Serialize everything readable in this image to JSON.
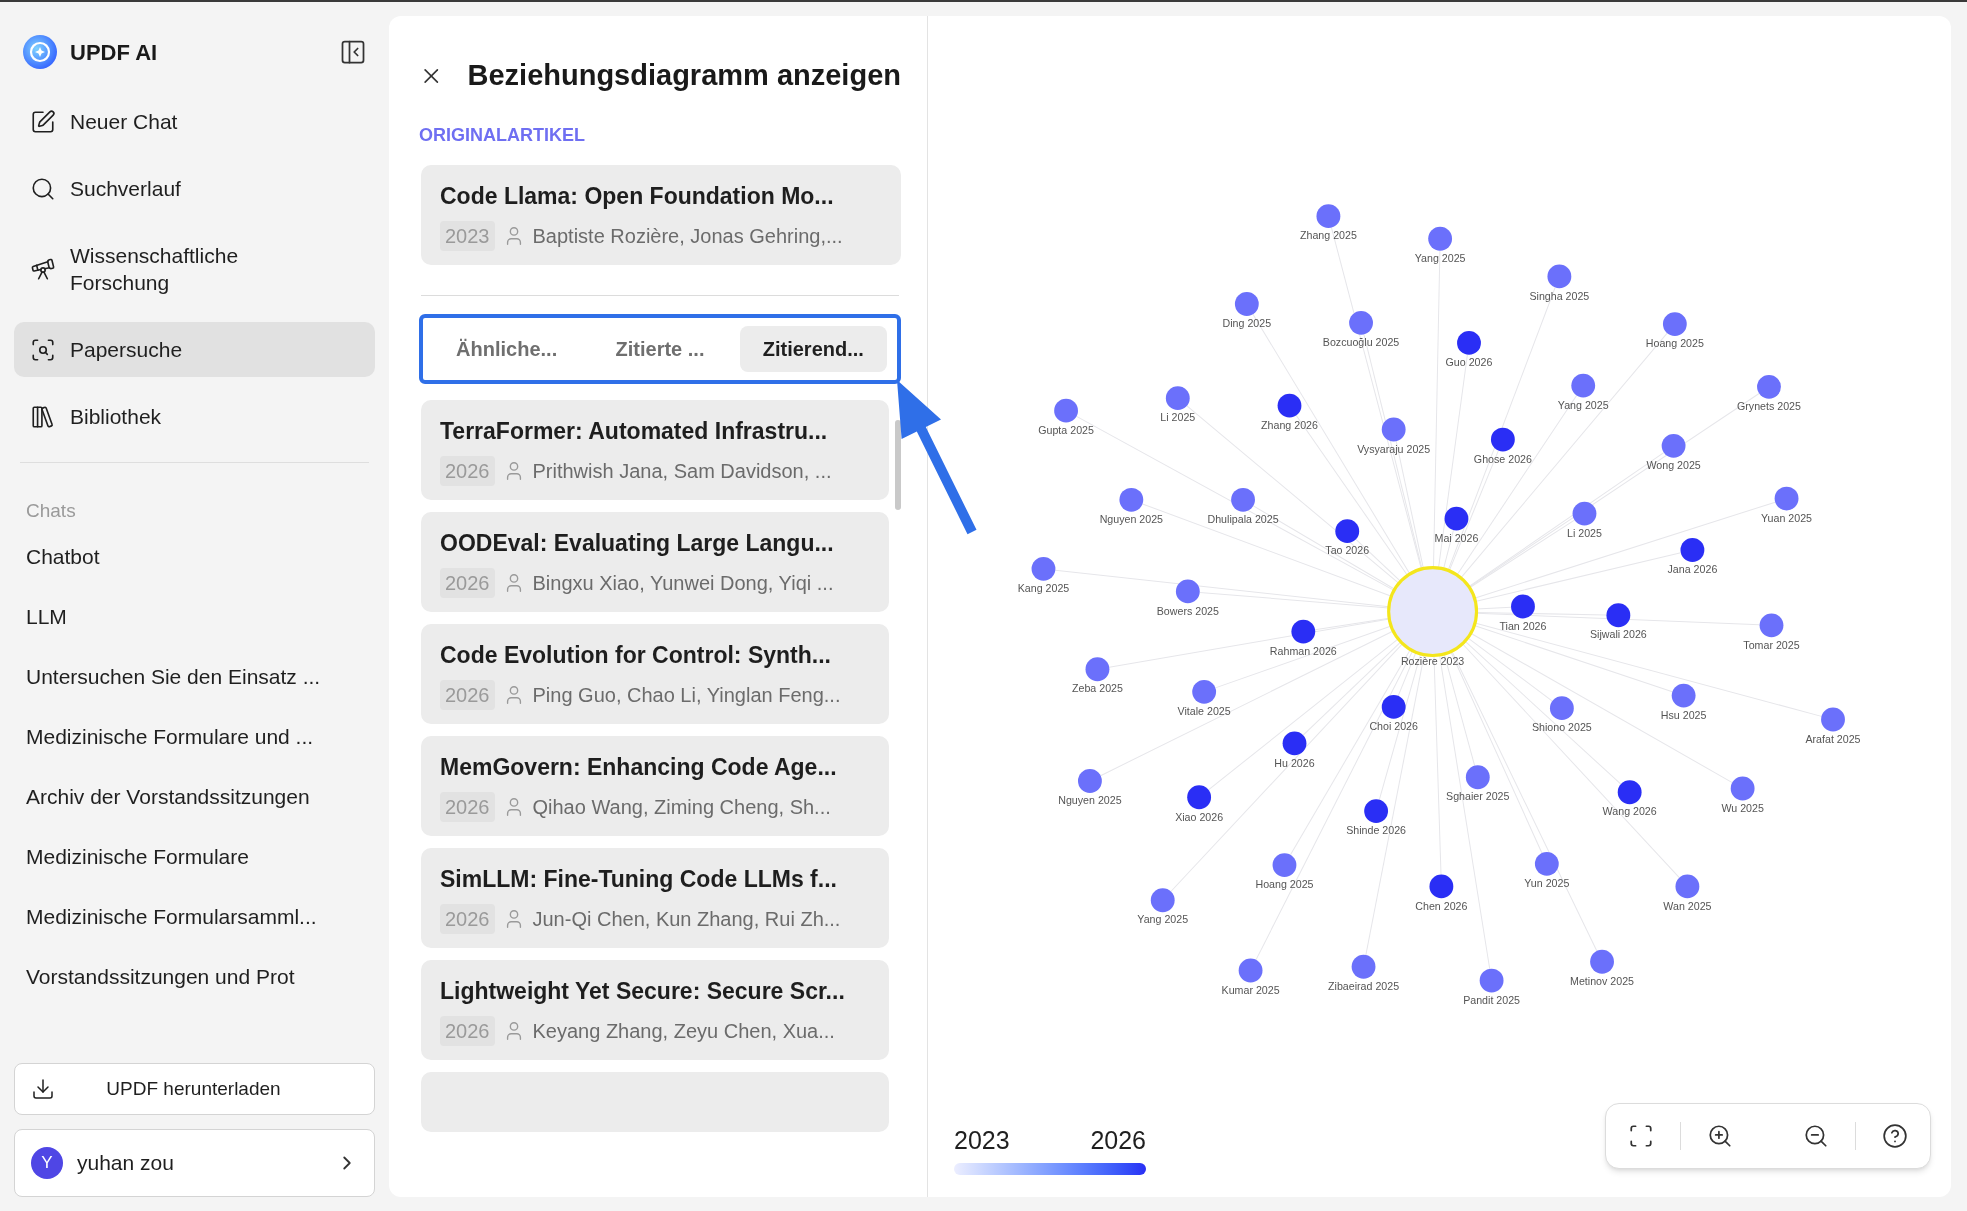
{
  "app": {
    "name": "UPDF AI"
  },
  "sidebar": {
    "nav": [
      {
        "label": "Neuer Chat",
        "selected": false
      },
      {
        "label": "Suchverlauf",
        "selected": false
      },
      {
        "label": "Wissenschaftliche Forschung",
        "selected": false
      },
      {
        "label": "Papersuche",
        "selected": true
      },
      {
        "label": "Bibliothek",
        "selected": false
      }
    ],
    "chats_heading": "Chats",
    "chats": [
      "Chatbot",
      "LLM",
      "Untersuchen Sie den Einsatz ...",
      "Medizinische Formulare und ...",
      "Archiv der Vorstandssitzungen",
      "Medizinische Formulare",
      "Medizinische Formularsamml...",
      "Vorstandssitzungen und Prot"
    ],
    "download_button": "UPDF herunterladen",
    "user": {
      "initial": "Y",
      "name": "yuhan zou"
    }
  },
  "panel": {
    "title": "Beziehungsdiagramm anzeigen",
    "section_label": "ORIGINALARTIKEL",
    "original": {
      "title": "Code Llama: Open Foundation Mo...",
      "year": "2023",
      "authors": "Baptiste Rozière, Jonas Gehring,..."
    },
    "tabs": [
      {
        "label": "Ähnliche...",
        "selected": false
      },
      {
        "label": "Zitierte ...",
        "selected": false
      },
      {
        "label": "Zitierend...",
        "selected": true
      }
    ],
    "papers": [
      {
        "title": "TerraFormer: Automated Infrastru...",
        "year": "2026",
        "authors": "Prithwish Jana, Sam Davidson, ..."
      },
      {
        "title": "OODEval: Evaluating Large Langu...",
        "year": "2026",
        "authors": "Bingxu Xiao, Yunwei Dong, Yiqi ..."
      },
      {
        "title": "Code Evolution for Control: Synth...",
        "year": "2026",
        "authors": "Ping Guo, Chao Li, Yinglan Feng..."
      },
      {
        "title": "MemGovern: Enhancing Code Age...",
        "year": "2026",
        "authors": "Qihao Wang, Ziming Cheng, Sh..."
      },
      {
        "title": "SimLLM: Fine-Tuning Code LLMs f...",
        "year": "2026",
        "authors": "Jun-Qi Chen, Kun Zhang, Rui Zh..."
      },
      {
        "title": "Lightweight Yet Secure: Secure Scr...",
        "year": "2026",
        "authors": "Keyang Zhang, Zeyu Chen, Xua..."
      }
    ]
  },
  "graph": {
    "center": {
      "label": "Rozière 2023"
    },
    "nodes": [
      {
        "label": "Zhang 2025",
        "color": "#6b70fb"
      },
      {
        "label": "Yang 2025",
        "color": "#6b70fb"
      },
      {
        "label": "Singha 2025",
        "color": "#6b70fb"
      },
      {
        "label": "Ding 2025",
        "color": "#6b70fb"
      },
      {
        "label": "Bozcuoğlu 2025",
        "color": "#6b70fb"
      },
      {
        "label": "Guo 2026",
        "color": "#2a2ef5"
      },
      {
        "label": "Hoang 2025",
        "color": "#6b70fb"
      },
      {
        "label": "Gupta 2025",
        "color": "#6b70fb"
      },
      {
        "label": "Li 2025",
        "color": "#6b70fb"
      },
      {
        "label": "Zhang 2026",
        "color": "#2a2ef5"
      },
      {
        "label": "Yang 2025",
        "color": "#6b70fb"
      },
      {
        "label": "Grynets 2025",
        "color": "#6b70fb"
      },
      {
        "label": "Vysyaraju 2025",
        "color": "#6b70fb"
      },
      {
        "label": "Ghose 2026",
        "color": "#2a2ef5"
      },
      {
        "label": "Wong 2025",
        "color": "#6b70fb"
      },
      {
        "label": "Nguyen 2025",
        "color": "#6b70fb"
      },
      {
        "label": "Dhulipala 2025",
        "color": "#6b70fb"
      },
      {
        "label": "Tao 2026",
        "color": "#2a2ef5"
      },
      {
        "label": "Mai 2026",
        "color": "#2a2ef5"
      },
      {
        "label": "Li 2025",
        "color": "#6b70fb"
      },
      {
        "label": "Yuan 2025",
        "color": "#6b70fb"
      },
      {
        "label": "Jana 2026",
        "color": "#2a2ef5"
      },
      {
        "label": "Kang 2025",
        "color": "#6b70fb"
      },
      {
        "label": "Bowers 2025",
        "color": "#6b70fb"
      },
      {
        "label": "Rahman 2026",
        "color": "#2a2ef5"
      },
      {
        "label": "Tian 2026",
        "color": "#2a2ef5"
      },
      {
        "label": "Sijwali 2026",
        "color": "#2a2ef5"
      },
      {
        "label": "Tomar 2025",
        "color": "#6b70fb"
      },
      {
        "label": "Zeba 2025",
        "color": "#6b70fb"
      },
      {
        "label": "Vitale 2025",
        "color": "#6b70fb"
      },
      {
        "label": "Choi 2026",
        "color": "#2a2ef5"
      },
      {
        "label": "Shiono 2025",
        "color": "#6b70fb"
      },
      {
        "label": "Hsu 2025",
        "color": "#6b70fb"
      },
      {
        "label": "Arafat 2025",
        "color": "#6b70fb"
      },
      {
        "label": "Nguyen 2025",
        "color": "#6b70fb"
      },
      {
        "label": "Hu 2026",
        "color": "#2a2ef5"
      },
      {
        "label": "Xiao 2026",
        "color": "#2a2ef5"
      },
      {
        "label": "Sghaier 2025",
        "color": "#6b70fb"
      },
      {
        "label": "Wang 2026",
        "color": "#2a2ef5"
      },
      {
        "label": "Wu 2025",
        "color": "#6b70fb"
      },
      {
        "label": "Shinde 2026",
        "color": "#2a2ef5"
      },
      {
        "label": "Hoang 2025",
        "color": "#6b70fb"
      },
      {
        "label": "Yun 2025",
        "color": "#6b70fb"
      },
      {
        "label": "Yang 2025",
        "color": "#6b70fb"
      },
      {
        "label": "Chen 2026",
        "color": "#2a2ef5"
      },
      {
        "label": "Wan 2025",
        "color": "#6b70fb"
      },
      {
        "label": "Kumar 2025",
        "color": "#6b70fb"
      },
      {
        "label": "Zibaeirad 2025",
        "color": "#6b70fb"
      },
      {
        "label": "Pandit 2025",
        "color": "#6b70fb"
      },
      {
        "label": "Metinov 2025",
        "color": "#6b70fb"
      }
    ],
    "legend": {
      "start": "2023",
      "end": "2026"
    }
  }
}
